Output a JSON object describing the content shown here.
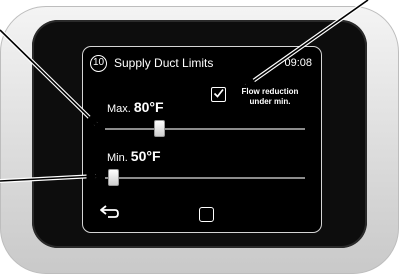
{
  "header": {
    "menu_number": "10",
    "title": "Supply Duct Limits",
    "time": "09:08"
  },
  "flow_reduction": {
    "label_line1": "Flow reduction",
    "label_line2": "under min.",
    "checked": true
  },
  "max_limit": {
    "label": "Max.",
    "value": "80°F",
    "slider_fraction": 0.27
  },
  "min_limit": {
    "label": "Min.",
    "value": "50°F",
    "slider_fraction": 0.04
  },
  "footer": {
    "back_icon": "back-arrow-icon",
    "home_icon": "home-square-icon"
  },
  "colors": {
    "screen_bg": "#000000",
    "bezel": "#0d0d0d",
    "frame": "#e0e0e0",
    "track": "#8c8c8c",
    "text": "#ffffff"
  }
}
